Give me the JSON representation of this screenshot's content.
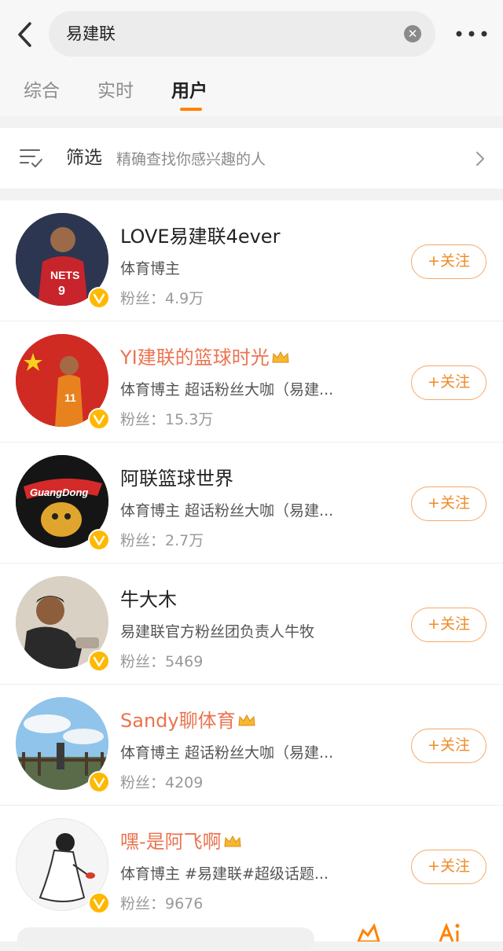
{
  "search": {
    "query": "易建联"
  },
  "tabs": [
    {
      "label": "综合"
    },
    {
      "label": "实时"
    },
    {
      "label": "用户"
    }
  ],
  "filter": {
    "title": "筛选",
    "subtitle": "精确查找你感兴趣的人"
  },
  "follow_label": "+关注",
  "users": [
    {
      "name": "LOVE易建联4ever",
      "desc": "体育博主",
      "fans": "粉丝：4.9万",
      "name_color": "#222222",
      "crown": false
    },
    {
      "name": "YI建联的篮球时光",
      "desc": "体育博主 超话粉丝大咖（易建...",
      "fans": "粉丝：15.3万",
      "name_color": "#eb7350",
      "crown": true
    },
    {
      "name": "阿联篮球世界",
      "desc": "体育博主 超话粉丝大咖（易建...",
      "fans": "粉丝：2.7万",
      "name_color": "#222222",
      "crown": false
    },
    {
      "name": "牛大木",
      "desc": "易建联官方粉丝团负责人牛牧",
      "fans": "粉丝：5469",
      "name_color": "#222222",
      "crown": false
    },
    {
      "name": "Sandy聊体育",
      "desc": "体育博主 超话粉丝大咖（易建...",
      "fans": "粉丝：4209",
      "name_color": "#eb7350",
      "crown": true
    },
    {
      "name": "嘿-是阿飞啊",
      "desc": "体育博主 #易建联#超级话题...",
      "fans": "粉丝：9676",
      "name_color": "#eb7350",
      "crown": true
    }
  ],
  "icons": {
    "back": "chevron-left-icon",
    "clear": "clear-icon",
    "more": "more-icon",
    "filter": "filter-icon",
    "arrow": "chevron-right-icon",
    "verified": "verified-badge-icon",
    "crown": "crown-icon"
  },
  "colors": {
    "accent": "#ff8200",
    "follow": "#f08a24",
    "vip_name": "#eb7350",
    "verified": "#ffb800"
  }
}
